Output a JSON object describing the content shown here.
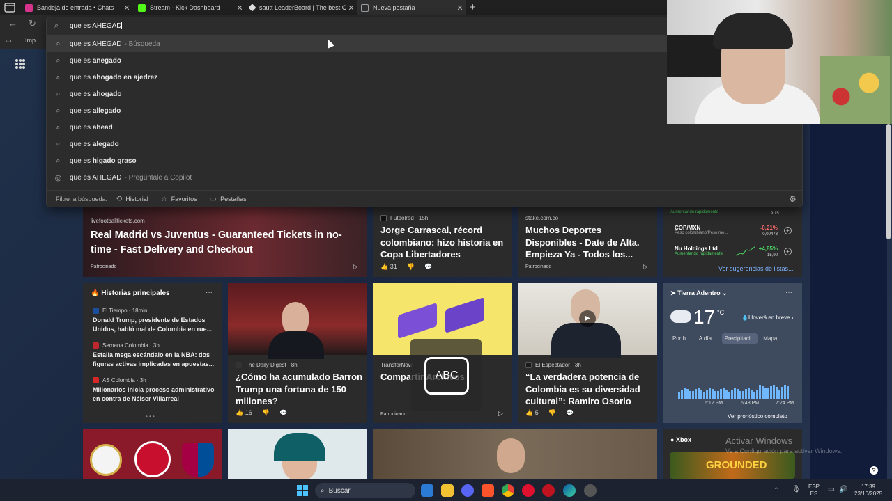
{
  "browser": {
    "tabs": [
      {
        "label": "Bandeja de entrada • Chats",
        "icon": "instagram-icon",
        "color": "#d6338c",
        "active": false
      },
      {
        "label": "Stream - Kick Dashboard",
        "icon": "kick-icon",
        "color": "#53fc18",
        "active": false
      },
      {
        "label": "sautt LeaderBoard | The best Cha",
        "icon": "diamond-icon",
        "color": "#dddddd",
        "active": false
      },
      {
        "label": "Nueva pestaña",
        "icon": "newtab-icon",
        "color": "#9aa0a6",
        "active": true
      }
    ],
    "new_tab_symbol": "+",
    "close_symbol": "✕",
    "favbar_item": "Imp"
  },
  "omnibox": {
    "query": "que es AHEGAD",
    "suggestions": [
      {
        "prefix": "que es AHEGAD",
        "bold": "",
        "suffix": "- Búsqueda",
        "icon": "search-icon",
        "highlighted": true
      },
      {
        "prefix": "que es ",
        "bold": "anegado",
        "suffix": "",
        "icon": "search-icon"
      },
      {
        "prefix": "que es ",
        "bold": "ahogado en ajedrez",
        "suffix": "",
        "icon": "search-icon"
      },
      {
        "prefix": "que es ",
        "bold": "ahogado",
        "suffix": "",
        "icon": "search-icon"
      },
      {
        "prefix": "que es ",
        "bold": "allegado",
        "suffix": "",
        "icon": "search-icon"
      },
      {
        "prefix": "que es ",
        "bold": "ahead",
        "suffix": "",
        "icon": "search-icon"
      },
      {
        "prefix": "que es ",
        "bold": "alegado",
        "suffix": "",
        "icon": "search-icon"
      },
      {
        "prefix": "que es ",
        "bold": "higado graso",
        "suffix": "",
        "icon": "search-icon"
      },
      {
        "prefix": "que es AHEGAD",
        "bold": "",
        "suffix": "- Pregúntale a Copilot",
        "icon": "copilot-icon"
      }
    ],
    "filter_label": "Filtre la búsqueda:",
    "filters": [
      {
        "label": "Historial",
        "icon": "history-icon"
      },
      {
        "label": "Favoritos",
        "icon": "star-icon"
      },
      {
        "label": "Pestañas",
        "icon": "tabs-icon"
      }
    ]
  },
  "feed": {
    "row1": [
      {
        "source": "livefootballtickets.com",
        "title": "Real Madrid vs Juventus - Guaranteed Tickets in no-time - Fast Delivery and Checkout",
        "tag": "Patrocinado"
      },
      {
        "source": "Futbolred",
        "time": "15h",
        "title": "Jorge Carrascal, récord colombiano: hizo historia en Copa Libertadores",
        "likes": "31"
      },
      {
        "source": "stake.com.co",
        "title": "Muchos Deportes Disponibles - Date de Alta. Empieza Ya - Todos los...",
        "tag": "Patrocinado"
      }
    ],
    "stocks": [
      {
        "name": "COP/MXN",
        "sub": "Peso colombiano/Peso me...",
        "pct": "-0,21%",
        "price": "0,00473",
        "color": "#ff6b6b"
      },
      {
        "name": "Nu Holdings Ltd",
        "sub": "Aumentando rápidamente",
        "pct": "+4,85%",
        "price": "15,90",
        "color": "#4cd964"
      }
    ],
    "stock_top_price": "9,15",
    "stock_top_sub": "Aumentando rápidamente",
    "stock_link": "Ver sugerencias de listas...",
    "historias": {
      "header": "Historias principales",
      "items": [
        {
          "source": "El Tiempo",
          "time": "18min",
          "title": "Donald Trump, presidente de Estados Unidos, habló mal de Colombia en rue..."
        },
        {
          "source": "Semana Colombia",
          "time": "3h",
          "title": "Estalla mega escándalo en la NBA: dos figuras activas implicadas en apuestas..."
        },
        {
          "source": "AS Colombia",
          "time": "3h",
          "title": "Millonarios inicia proceso administrativo en contra de Néiser Villarreal"
        }
      ]
    },
    "row2": [
      {
        "source": "The Daily Digest",
        "time": "8h",
        "title": "¿Cómo ha acumulado Barron Trump una fortuna de 150 millones?",
        "likes": "16"
      },
      {
        "source": "TransferNow",
        "title": "Compartir Archivos",
        "tag": "Patrocinado",
        "overlay": "ABC"
      },
      {
        "source": "El Espectador",
        "time": "3h",
        "title": "“La verdadera potencia de Colombia es su diversidad cultural”: Ramiro Osorio",
        "likes": "5"
      }
    ],
    "weather": {
      "location": "Tierra Adentro",
      "temp": "17",
      "unit": "°C",
      "forecast": "Lloverá en breve",
      "tabs": [
        "Por h...",
        "A día...",
        "Precipitaci...",
        "Mapa"
      ],
      "times": [
        "6:12 PM",
        "6:48 PM",
        "7:24 PM"
      ],
      "link": "Ver pronóstico completo"
    },
    "xbox": {
      "label": "Xbox",
      "game": "GROUNDED"
    }
  },
  "windows": {
    "activate_title": "Activar Windows",
    "activate_sub": "Ve a Configuración para activar Windows.",
    "search_label": "Buscar",
    "lang": "ESP",
    "lang_sub": "ES",
    "time": "17:39",
    "date": "23/10/2025"
  }
}
